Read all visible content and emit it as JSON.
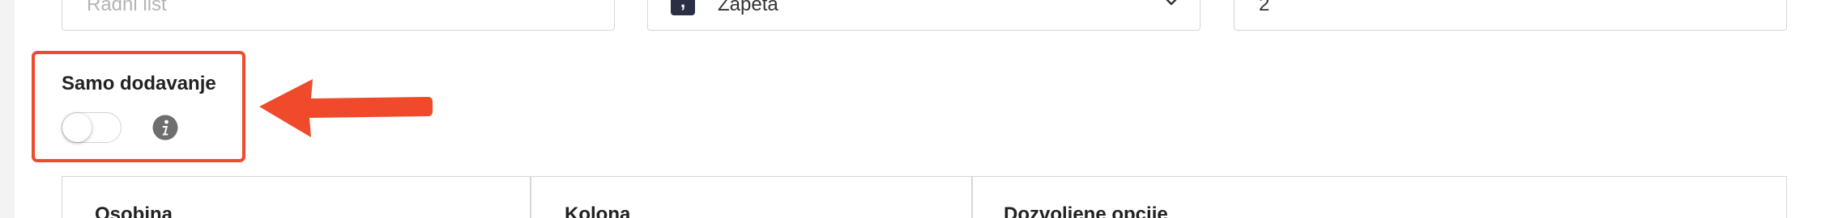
{
  "form": {
    "sheet_field": {
      "placeholder": "Radni list"
    },
    "delimiter_field": {
      "chip": ",",
      "value": "Zapeta"
    },
    "row_field": {
      "value": "2"
    }
  },
  "append_only": {
    "label": "Samo dodavanje",
    "enabled": false
  },
  "mapping_table": {
    "columns": [
      "Osobina",
      "Kolona",
      "Dozvoljene opcije"
    ]
  },
  "colors": {
    "highlight": "#ef4a2b",
    "chip_bg": "#2a2f45",
    "info_icon": "#6e6e6e",
    "border": "#d6d6d6"
  },
  "icons": {
    "delimiter": "chevron-down-icon",
    "append_only_help": "info-icon",
    "annotation": "arrow-left-icon"
  }
}
